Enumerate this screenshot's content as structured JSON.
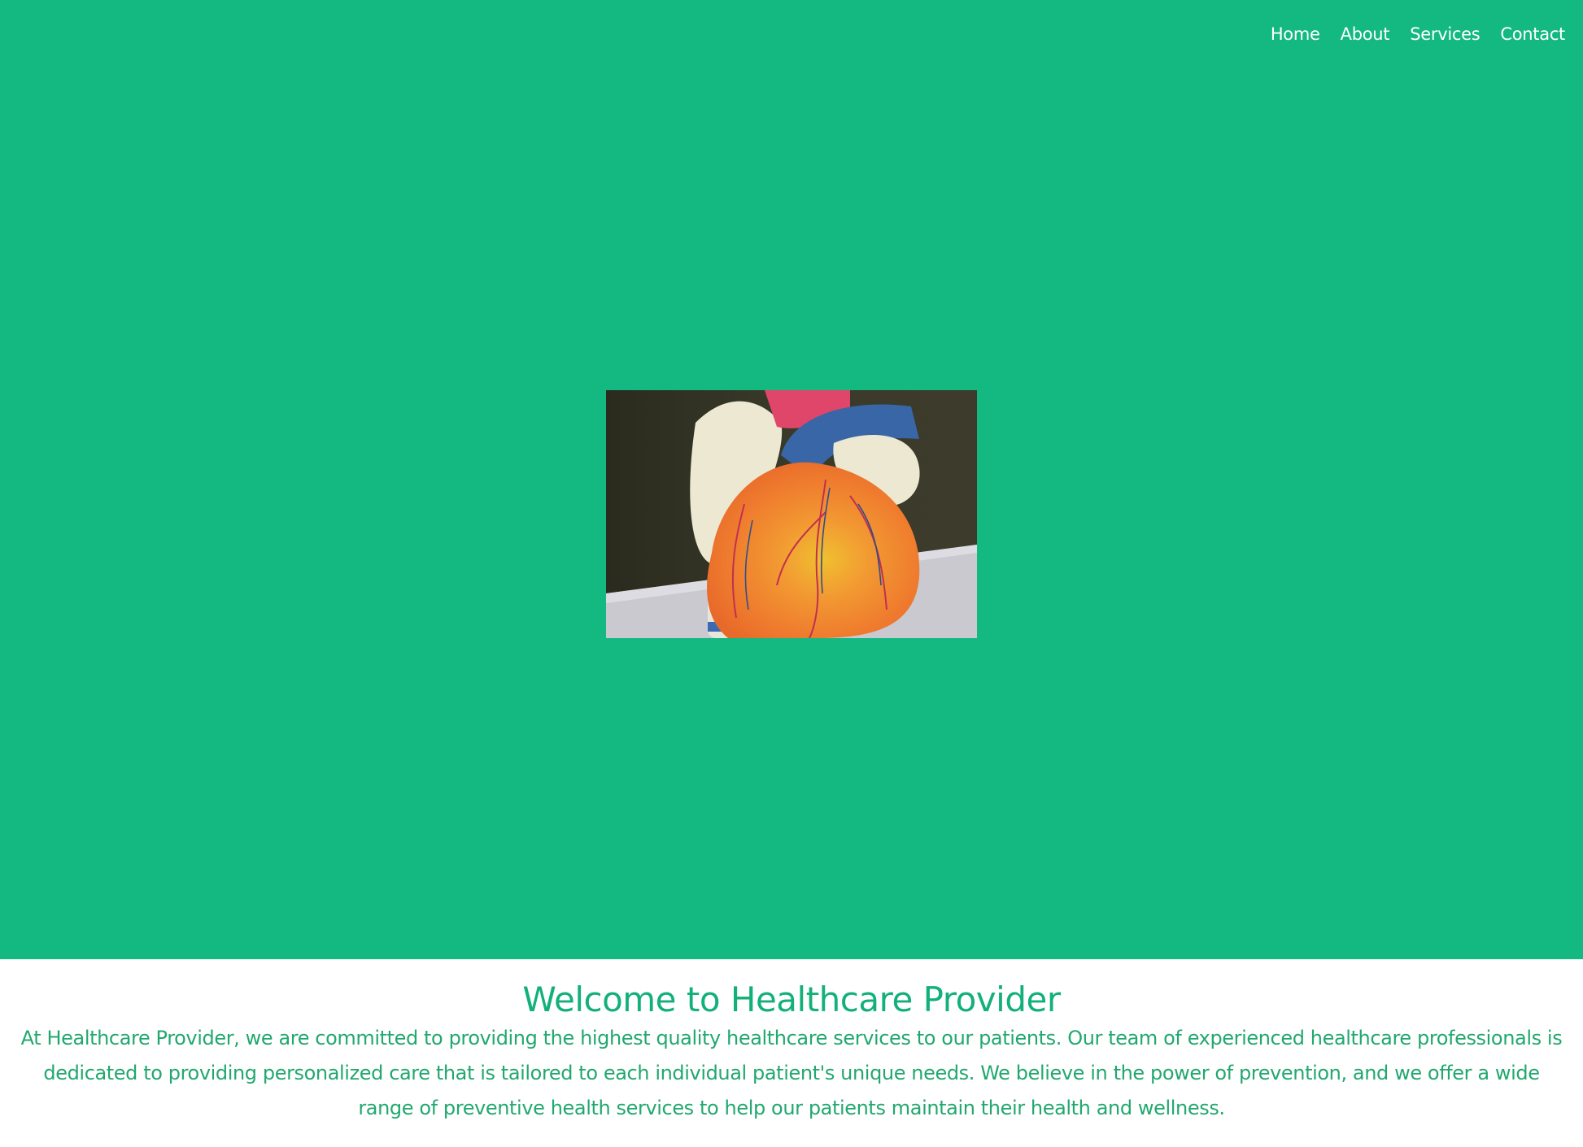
{
  "colors": {
    "hero_background": "#13b981",
    "nav_text": "#ffffff",
    "heading_text": "#13b07a",
    "body_text": "#22a86f",
    "page_background": "#ffffff"
  },
  "nav": {
    "items": [
      {
        "label": "Home"
      },
      {
        "label": "About"
      },
      {
        "label": "Services"
      },
      {
        "label": "Contact"
      }
    ]
  },
  "hero": {
    "image_alt": "Anatomical heart model"
  },
  "main": {
    "title": "Welcome to Healthcare Provider",
    "intro": "At Healthcare Provider, we are committed to providing the highest quality healthcare services to our patients. Our team of experienced healthcare professionals is dedicated to providing personalized care that is tailored to each individual patient's unique needs. We believe in the power of prevention, and we offer a wide range of preventive health services to help our patients maintain their health and wellness."
  }
}
